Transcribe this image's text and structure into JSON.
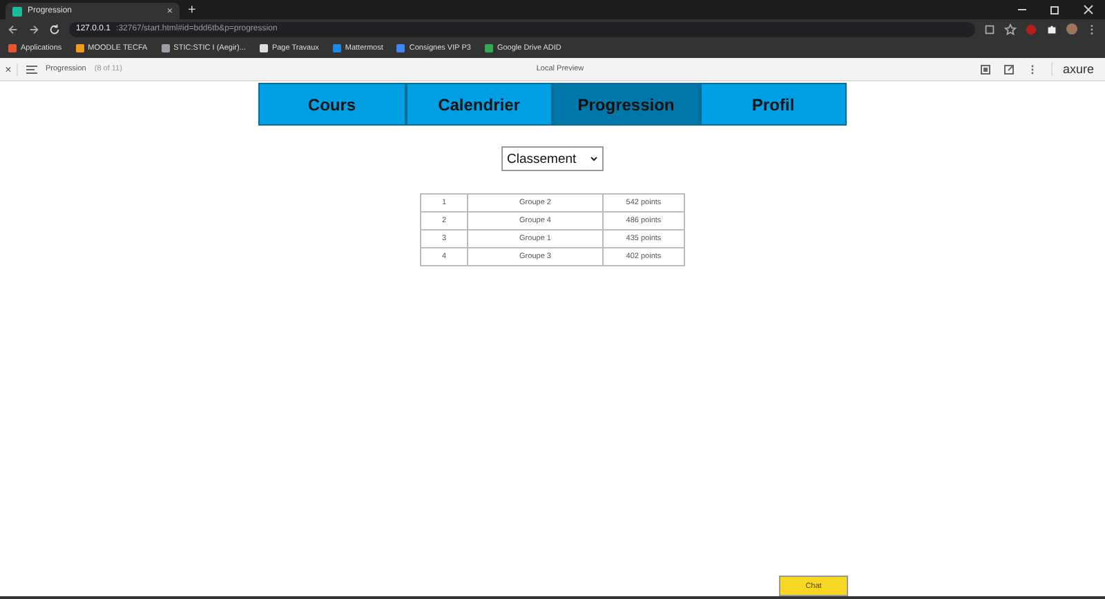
{
  "browser": {
    "tab": {
      "title": "Progression",
      "close": "×"
    },
    "new_tab": "+",
    "address": {
      "host": "127.0.0.1",
      "rest": ":32767/start.html#id=bdd6tb&p=progression"
    },
    "bookmarks": [
      {
        "label": "Applications",
        "color": "#e4572e"
      },
      {
        "label": "MOODLE TECFA",
        "color": "#f29c1f"
      },
      {
        "label": "STIC:STIC I (Aegir)...",
        "color": "#9aa0a6"
      },
      {
        "label": "Page Travaux",
        "color": "#dddddd"
      },
      {
        "label": "Mattermost",
        "color": "#1e88e5"
      },
      {
        "label": "Consignes VIP P3",
        "color": "#4285f4"
      },
      {
        "label": "Google Drive ADID",
        "color": "#34a853"
      }
    ]
  },
  "preview_bar": {
    "close": "×",
    "page": "Progression",
    "count": "(8 of 11)",
    "title": "Local Preview",
    "logo": "axure"
  },
  "nav_tabs": [
    {
      "label": "Cours",
      "selected": false
    },
    {
      "label": "Calendrier",
      "selected": false
    },
    {
      "label": "Progression",
      "selected": true
    },
    {
      "label": "Profil",
      "selected": false
    }
  ],
  "dropdown": {
    "value": "Classement"
  },
  "ranking": [
    {
      "rank": "1",
      "group": "Groupe 2",
      "points": "542 points"
    },
    {
      "rank": "2",
      "group": "Groupe 4",
      "points": "486 points"
    },
    {
      "rank": "3",
      "group": "Groupe 1",
      "points": "435 points"
    },
    {
      "rank": "4",
      "group": "Groupe 3",
      "points": "402 points"
    }
  ],
  "chat_button": "Chat"
}
